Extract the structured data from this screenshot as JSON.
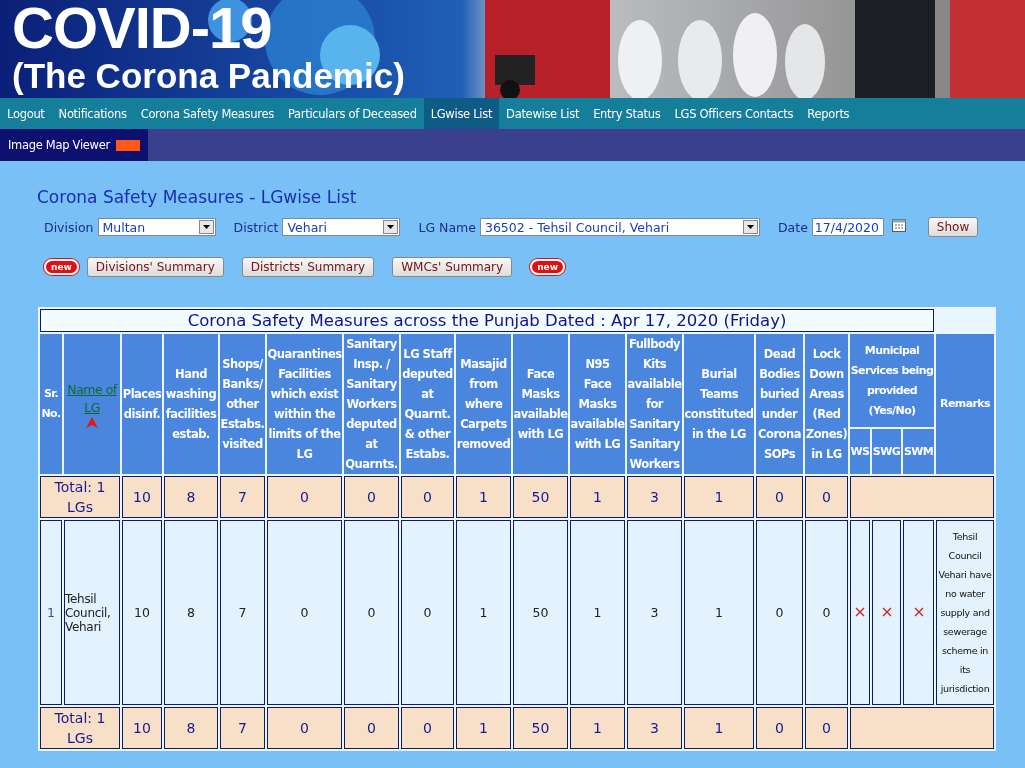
{
  "banner": {
    "title": "COVID-19",
    "subtitle": "(The Corona Pandemic)"
  },
  "nav": [
    {
      "label": "Logout",
      "selected": false
    },
    {
      "label": "Notifications",
      "selected": false
    },
    {
      "label": "Corona Safety Measures",
      "selected": false
    },
    {
      "label": "Particulars of Deceased",
      "selected": false
    },
    {
      "label": "LGwise List",
      "selected": true
    },
    {
      "label": "Datewise List",
      "selected": false
    },
    {
      "label": "Entry Status",
      "selected": false
    },
    {
      "label": "LGS Officers Contacts",
      "selected": false
    },
    {
      "label": "Reports",
      "selected": false
    }
  ],
  "subnav": {
    "label": "Image Map Viewer"
  },
  "page_title": "Corona Safety Measures - LGwise List",
  "filters": [
    {
      "kind": "select",
      "label": "Division",
      "value": "Multan"
    },
    {
      "kind": "select",
      "label": "District",
      "value": "Vehari"
    },
    {
      "kind": "select",
      "label": "LG Name",
      "value": "36502 - Tehsil Council, Vehari"
    },
    {
      "kind": "date",
      "label": "Date",
      "value": "17/4/2020"
    }
  ],
  "show_button": "Show",
  "summary_buttons": [
    {
      "kind": "badge",
      "label": "new"
    },
    {
      "kind": "button",
      "label": "Divisions' Summary"
    },
    {
      "kind": "button",
      "label": "Districts' Summary"
    },
    {
      "kind": "button",
      "label": "WMCs' Summary"
    },
    {
      "kind": "badge",
      "label": "new"
    }
  ],
  "table": {
    "title": "Corona Safety Measures across the Punjab Dated : Apr 17, 2020 (Friday)",
    "columns": [
      {
        "label": "Sr. No.",
        "kind": "plain"
      },
      {
        "label": "Name of LG",
        "kind": "sort"
      },
      {
        "label": "Places disinf.",
        "kind": "plain"
      },
      {
        "label": "Hand washing facilities estab.",
        "kind": "plain"
      },
      {
        "label": "Shops/ Banks/ other Estabs. visited",
        "kind": "plain"
      },
      {
        "label": "Quarantines Facilities which exist within the limits of the LG",
        "kind": "plain"
      },
      {
        "label": "Sanitary Insp. / Sanitary Workers deputed at Quarnts.",
        "kind": "plain"
      },
      {
        "label": "LG Staff deputed at Quarnt. & other Estabs.",
        "kind": "plain"
      },
      {
        "label": "Masajid from where Carpets removed",
        "kind": "plain"
      },
      {
        "label": "Face Masks available with LG",
        "kind": "plain"
      },
      {
        "label": "N95 Face Masks available with LG",
        "kind": "plain"
      },
      {
        "label": "Fullbody Kits available for Sanitary Sanitary Workers",
        "kind": "plain"
      },
      {
        "label": "Burial Teams constituted in the LG",
        "kind": "plain"
      },
      {
        "label": "Dead Bodies buried under Corona SOPs",
        "kind": "plain"
      },
      {
        "label": "Lock Down Areas (Red Zones) in LG",
        "kind": "plain"
      }
    ],
    "group": {
      "label": "Municipal Services being provided (Yes/No)",
      "columns": [
        "WS",
        "SWG",
        "SWM"
      ]
    },
    "remarks_label": "Remarks",
    "total_top": {
      "label": "Total: 1 LGs",
      "values": [
        "10",
        "8",
        "7",
        "0",
        "0",
        "0",
        "1",
        "50",
        "1",
        "3",
        "1",
        "0",
        "0"
      ]
    },
    "rows": [
      {
        "sr": "1",
        "name": "Tehsil Council, Vehari",
        "values": [
          "10",
          "8",
          "7",
          "0",
          "0",
          "0",
          "1",
          "50",
          "1",
          "3",
          "1",
          "0",
          "0"
        ],
        "services": [
          {
            "provided": false
          },
          {
            "provided": false
          },
          {
            "provided": false
          }
        ],
        "remarks": "Tehsil Council Vehari have no water supply and sewerage scheme in its jurisdiction"
      }
    ],
    "total_bottom": {
      "label": "Total: 1 LGs",
      "values": [
        "10",
        "8",
        "7",
        "0",
        "0",
        "0",
        "1",
        "50",
        "1",
        "3",
        "1",
        "0",
        "0"
      ]
    }
  }
}
